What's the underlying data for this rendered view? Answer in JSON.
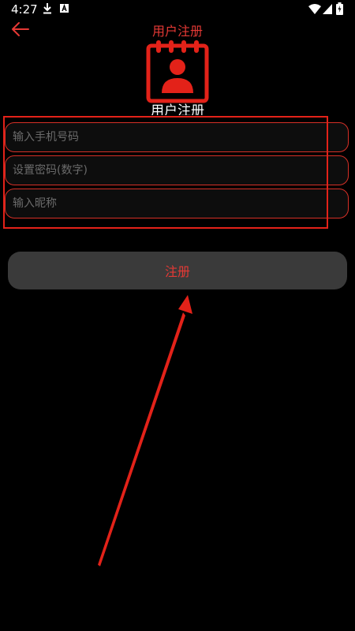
{
  "status_bar": {
    "time": "4:27",
    "icons": [
      "download-icon",
      "a-icon",
      "wifi-icon",
      "signal-icon",
      "battery-icon"
    ]
  },
  "header": {
    "title": "用户注册",
    "back_icon": "arrow-left-icon"
  },
  "logo": {
    "icon": "calendar-user-icon",
    "caption": "用户注册"
  },
  "form": {
    "phone_placeholder": "输入手机号码",
    "password_placeholder": "设置密码(数字)",
    "nickname_placeholder": "输入昵称",
    "submit_label": "注册"
  },
  "colors": {
    "accent": "#e53935",
    "field_border": "#d63027",
    "button_bg": "#3a3a3a",
    "annotation": "#e32219",
    "background": "#000000"
  }
}
